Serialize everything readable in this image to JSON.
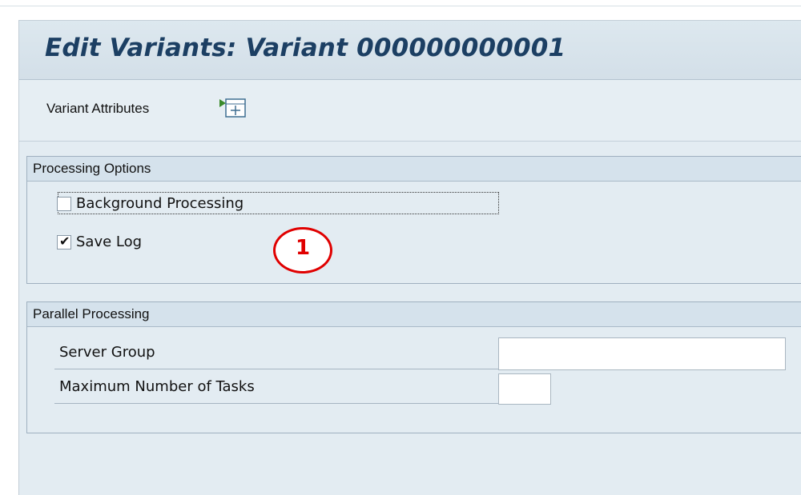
{
  "title": "Edit Variants: Variant 000000000001",
  "toolbar": {
    "variant_attributes_label": "Variant Attributes",
    "icon": "variant-attributes-icon"
  },
  "processing_options": {
    "header": "Processing Options",
    "background_processing": {
      "label": "Background Processing",
      "checked": false
    },
    "save_log": {
      "label": "Save Log",
      "checked": true,
      "tick_glyph": "✔"
    }
  },
  "parallel_processing": {
    "header": "Parallel Processing",
    "server_group": {
      "label": "Server Group",
      "value": ""
    },
    "max_tasks": {
      "label": "Maximum Number of Tasks",
      "value": ""
    }
  },
  "annotation": {
    "number": "1",
    "color": "#e00000"
  },
  "colors": {
    "title_text": "#1c3f63",
    "panel_bg": "#e3ecf2",
    "group_header_bg": "#d5e2ec"
  }
}
